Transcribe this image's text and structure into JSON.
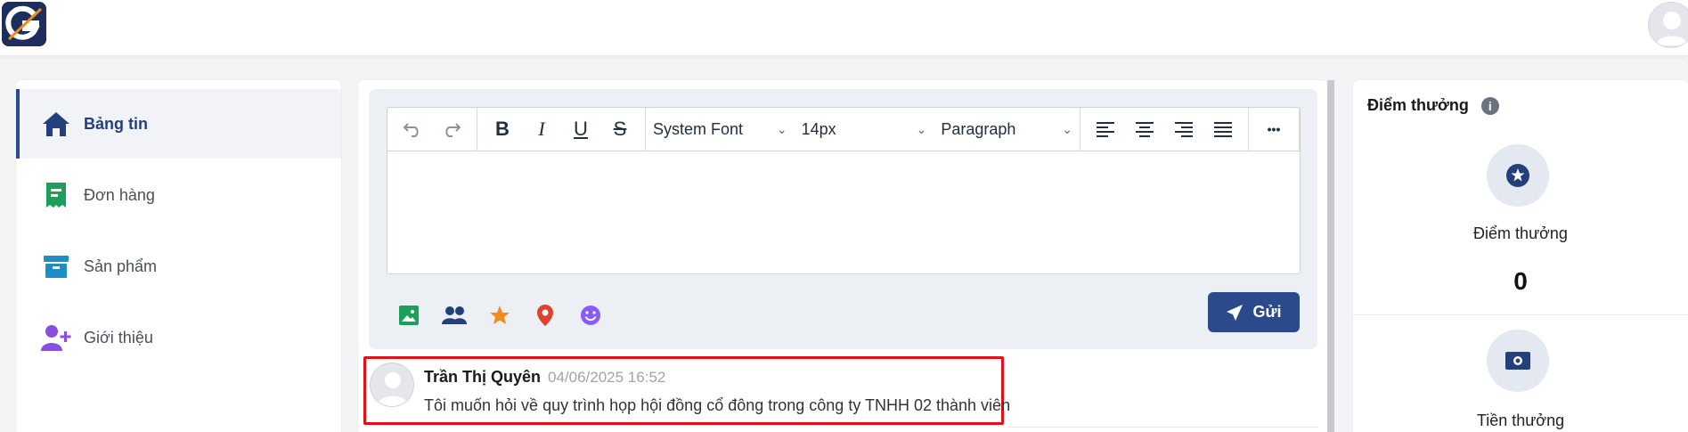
{
  "colors": {
    "accent": "#2b4a8b",
    "highlight_border": "#e3101a",
    "orders_icon": "#1aa05a",
    "products_icon": "#1d8ec4",
    "referral_icon": "#8a4fe0"
  },
  "header": {
    "logo_icon": "g-logo-icon",
    "avatar_icon": "user-avatar-icon"
  },
  "sidebar": {
    "items": [
      {
        "label": "Bảng tin",
        "icon": "home-icon",
        "active": true
      },
      {
        "label": "Đơn hàng",
        "icon": "receipt-icon",
        "active": false
      },
      {
        "label": "Sản phẩm",
        "icon": "archive-box-icon",
        "active": false
      },
      {
        "label": "Giới thiệu",
        "icon": "user-plus-icon",
        "active": false
      }
    ]
  },
  "editor": {
    "toolbar": {
      "undo_icon": "undo-icon",
      "redo_icon": "redo-icon",
      "bold": "B",
      "italic": "I",
      "underline": "U",
      "strike": "S",
      "font_family": "System Font",
      "font_size": "14px",
      "block_format": "Paragraph",
      "more": "•••"
    },
    "attachments": [
      "image-icon",
      "people-icon",
      "star-icon",
      "location-pin-icon",
      "emoji-icon"
    ],
    "send_label": "Gửi"
  },
  "post": {
    "author": "Trần Thị Quyên",
    "time": "04/06/2025 16:52",
    "text": "Tôi muốn hỏi về quy trình họp hội đồng cổ đông trong công ty TNHH 02 thành viên"
  },
  "rewards": {
    "title": "Điểm thưởng",
    "points_label": "Điểm thưởng",
    "points_value": "0",
    "cash_label": "Tiền thưởng"
  }
}
